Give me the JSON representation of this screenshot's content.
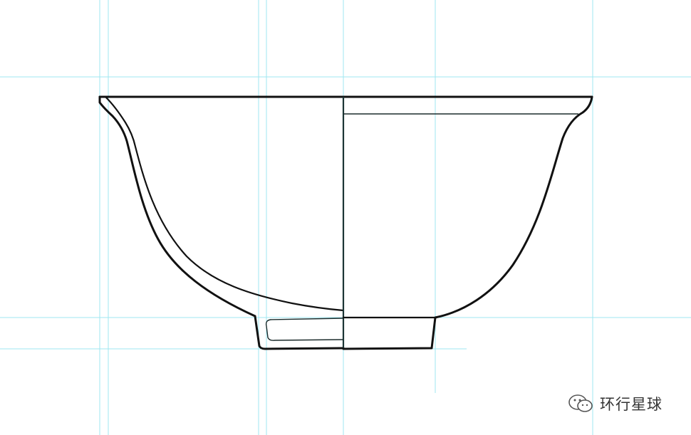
{
  "watermark": {
    "text": "环行星球",
    "icon": "wechat-icon"
  },
  "colors": {
    "guide": "#9fe7f0",
    "outline": "#111111",
    "background": "#ffffff"
  }
}
